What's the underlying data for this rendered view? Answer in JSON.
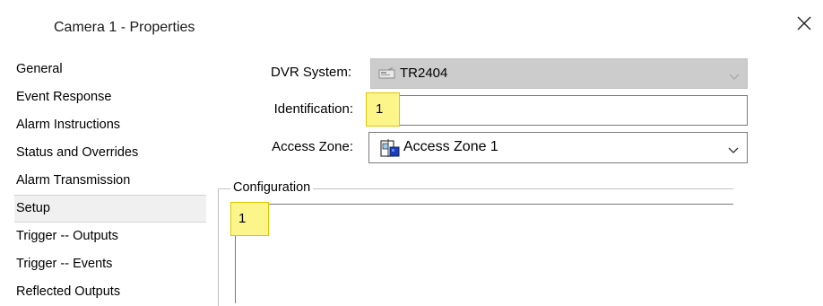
{
  "window": {
    "title": "Camera 1 - Properties"
  },
  "sidebar": {
    "items": [
      {
        "label": "General"
      },
      {
        "label": "Event Response"
      },
      {
        "label": "Alarm Instructions"
      },
      {
        "label": "Status and Overrides"
      },
      {
        "label": "Alarm Transmission"
      },
      {
        "label": "Setup",
        "selected": true
      },
      {
        "label": "Trigger -- Outputs"
      },
      {
        "label": "Trigger -- Events"
      },
      {
        "label": "Reflected Outputs"
      }
    ]
  },
  "form": {
    "dvr_system": {
      "label": "DVR System:",
      "value": "TR2404",
      "icon": "dvr-device-icon",
      "enabled": false
    },
    "identification": {
      "label": "Identification:",
      "value": "1"
    },
    "access_zone": {
      "label": "Access Zone:",
      "value": "Access Zone 1",
      "icon": "access-zone-icon"
    }
  },
  "configuration": {
    "title": "Configuration",
    "value": "1"
  },
  "colors": {
    "highlight": "#fbf58a",
    "highlight_border": "#e1c500",
    "disabled_field": "#cccccc"
  }
}
